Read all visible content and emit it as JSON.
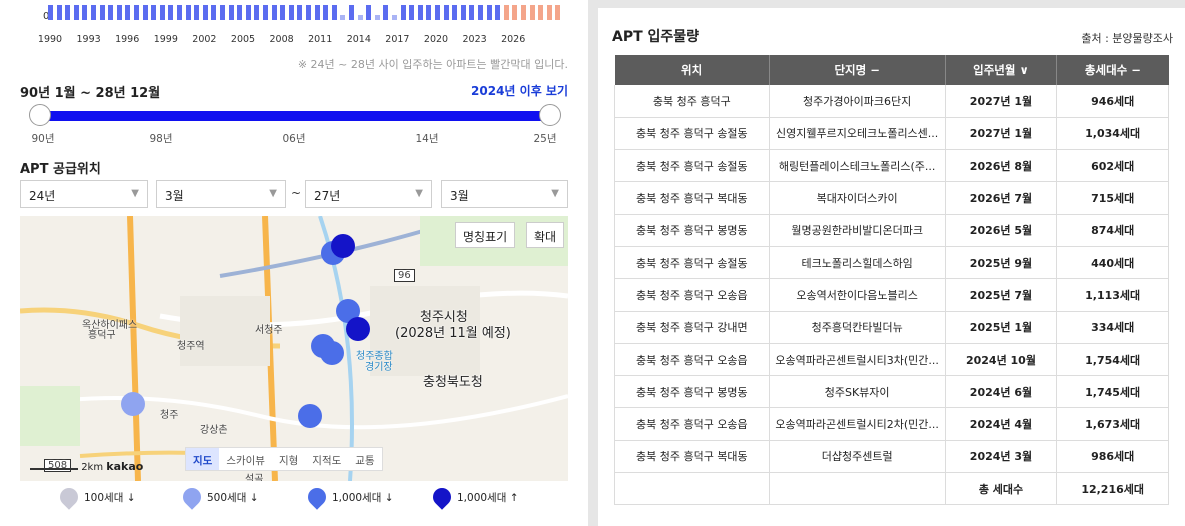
{
  "mini_chart": {
    "zero_label": "0",
    "x_ticks": [
      "1990",
      "1993",
      "1996",
      "1999",
      "2002",
      "2005",
      "2008",
      "2011",
      "2014",
      "2017",
      "2020",
      "2023",
      "2026"
    ],
    "bar_colors": {
      "normal": "#5b6cf0",
      "light": "#aab4f5",
      "future": "#f4a58a"
    }
  },
  "note": "※ 24년 ~ 28년 사이 입주하는 아파트는 빨간막대 입니다.",
  "range": {
    "title": "90년 1월 ~ 28년 12월",
    "link": "2024년 이후 보기",
    "labels": [
      "90년",
      "98년",
      "06년",
      "14년",
      "25년"
    ]
  },
  "supply": {
    "title": "APT 공급위치",
    "from_year": "24년",
    "from_month": "3월",
    "to_year": "27년",
    "to_month": "3월",
    "tilde": "~"
  },
  "map": {
    "btn_names": "명칭표기",
    "btn_zoom": "확대",
    "types": [
      "지도",
      "스카이뷰",
      "지형",
      "지적도",
      "교통"
    ],
    "scale": "2km",
    "brand": "kakao",
    "labels": {
      "city_hall": "청주시청",
      "city_hall_note": "(2028년 11월 예정)",
      "province": "충청북도청",
      "station": "청주역",
      "osong": "옥산하이패스",
      "heungdeok": "흥덕구",
      "seowon": "서청주",
      "stadium": "청주종합",
      "stadium2": "경기장",
      "cheongju": "청주",
      "gangseo": "강상촌",
      "road96": "96",
      "road508": "508",
      "seokgok": "석곡"
    }
  },
  "legend": [
    {
      "label": "100세대 ↓",
      "color": "#c9c9d6"
    },
    {
      "label": "500세대 ↓",
      "color": "#8fa4f0"
    },
    {
      "label": "1,000세대 ↓",
      "color": "#4b6ee8"
    },
    {
      "label": "1,000세대 ↑",
      "color": "#1414c8"
    }
  ],
  "apt": {
    "title": "APT 입주물량",
    "source": "출처 : 분양물량조사",
    "headers": [
      "위치",
      "단지명 −",
      "입주년월 ∨",
      "총세대수 −"
    ],
    "rows": [
      [
        "충북 청주 흥덕구",
        "청주가경아이파크6단지",
        "2027년 1월",
        "946세대"
      ],
      [
        "충북 청주 흥덕구 송절동",
        "신영지웰푸르지오테크노폴리스센...",
        "2027년 1월",
        "1,034세대"
      ],
      [
        "충북 청주 흥덕구 송절동",
        "해링턴플레이스테크노폴리스(주...",
        "2026년 8월",
        "602세대"
      ],
      [
        "충북 청주 흥덕구 복대동",
        "복대자이더스카이",
        "2026년 7월",
        "715세대"
      ],
      [
        "충북 청주 흥덕구 봉명동",
        "월명공원한라비발디온더파크",
        "2026년 5월",
        "874세대"
      ],
      [
        "충북 청주 흥덕구 송절동",
        "테크노폴리스힐데스하임",
        "2025년 9월",
        "440세대"
      ],
      [
        "충북 청주 흥덕구 오송읍",
        "오송역서한이다음노블리스",
        "2025년 7월",
        "1,113세대"
      ],
      [
        "충북 청주 흥덕구 강내면",
        "청주흥덕칸타빌더뉴",
        "2025년 1월",
        "334세대"
      ],
      [
        "충북 청주 흥덕구 오송읍",
        "오송역파라곤센트럴시티3차(민간...",
        "2024년 10월",
        "1,754세대"
      ],
      [
        "충북 청주 흥덕구 봉명동",
        "청주SK뷰자이",
        "2024년 6월",
        "1,745세대"
      ],
      [
        "충북 청주 흥덕구 오송읍",
        "오송역파라곤센트럴시티2차(민간...",
        "2024년 4월",
        "1,673세대"
      ],
      [
        "충북 청주 흥덕구 복대동",
        "더샵청주센트럴",
        "2024년 3월",
        "986세대"
      ]
    ],
    "total_label": "총 세대수",
    "total_value": "12,216세대"
  }
}
